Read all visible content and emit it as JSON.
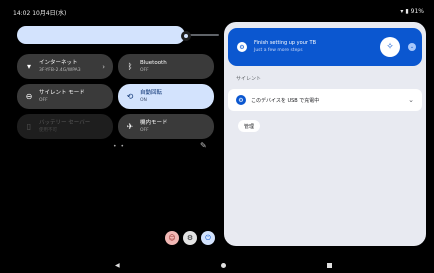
{
  "status_bar": {
    "time": "14:02",
    "date": "10月4日(水)",
    "wifi_icon": "wifi-icon",
    "battery_icon": "battery-icon",
    "battery_text": "91%"
  },
  "brightness": {
    "level": 0.85
  },
  "tiles": [
    {
      "id": "internet",
      "title": "インターネット",
      "subtitle": "3F-YFB-2.4G/WPA3",
      "icon": "wifi-icon",
      "state": "off",
      "has_chevron": true
    },
    {
      "id": "bluetooth",
      "title": "Bluetooth",
      "subtitle": "OFF",
      "icon": "bluetooth-icon",
      "state": "off"
    },
    {
      "id": "silent",
      "title": "サイレント モード",
      "subtitle": "OFF",
      "icon": "do-not-disturb-icon",
      "state": "off"
    },
    {
      "id": "auto-rotate",
      "title": "自動回転",
      "subtitle": "ON",
      "icon": "auto-rotate-icon",
      "state": "on"
    },
    {
      "id": "battery-saver",
      "title": "バッテリー セーバー",
      "subtitle": "使用不可",
      "icon": "battery-saver-icon",
      "state": "disabled"
    },
    {
      "id": "airplane",
      "title": "機内モード",
      "subtitle": "OFF",
      "icon": "airplane-icon",
      "state": "off"
    }
  ],
  "bottom_buttons": [
    {
      "id": "user",
      "icon": "user-icon",
      "bg": "#f2b8b5"
    },
    {
      "id": "settings",
      "icon": "settings-icon",
      "bg": "#e3e3e3"
    },
    {
      "id": "power",
      "icon": "power-icon",
      "bg": "#d3e3fd"
    }
  ],
  "notifications": {
    "setup": {
      "title": "Finish setting up your TB",
      "subtitle": "Just a few more steps"
    },
    "section_title": "サイレント",
    "usb": {
      "label": "このデバイスを USB で充電中"
    },
    "manage_label": "管理"
  },
  "colors": {
    "accent": "#0b57d0",
    "tile_on": "#d3e3fd",
    "tile_off": "#3a3a3a",
    "panel_bg": "#e8eaf1"
  }
}
